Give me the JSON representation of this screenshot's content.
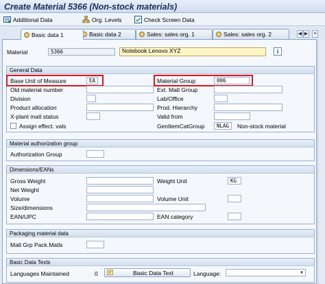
{
  "window": {
    "title": "Create Material 5366 (Non-stock materials)"
  },
  "toolbar": {
    "additional_data": "Additional Data",
    "org_levels": "Org. Levels",
    "check_screen_data": "Check Screen Data"
  },
  "tabs": [
    {
      "label": "Basic data 1",
      "active": true
    },
    {
      "label": "Basic data 2",
      "active": false
    },
    {
      "label": "Sales: sales org. 1",
      "active": false
    },
    {
      "label": "Sales: sales org. 2",
      "active": false
    }
  ],
  "header": {
    "material_label": "Material",
    "material_value": "5366",
    "description_value": "Notebook Lenovo XYZ",
    "info_icon": "info-icon"
  },
  "general": {
    "title": "General Data",
    "base_uom_label": "Base Unit of Measure",
    "base_uom_value": "EA",
    "old_material_label": "Old material number",
    "division_label": "Division",
    "product_allocation_label": "Product allocation",
    "xplant_status_label": "X-plant matl status",
    "assign_effect_label": "Assign effect. vals",
    "material_group_label": "Material Group",
    "material_group_value": "006",
    "ext_matl_group_label": "Ext. Matl Group",
    "lab_office_label": "Lab/Office",
    "prod_hierarchy_label": "Prod. Hierarchy",
    "valid_from_label": "Valid from",
    "gen_item_cat_label": "GenItemCatGroup",
    "gen_item_cat_value": "NLAG",
    "gen_item_cat_text": "Non-stock material"
  },
  "auth": {
    "title": "Material authorization group",
    "auth_group_label": "Authorization Group"
  },
  "dimensions": {
    "title": "Dimensions/EANs",
    "gross_weight_label": "Gross Weight",
    "net_weight_label": "Net Weight",
    "volume_label": "Volume",
    "size_label": "Size/dimensions",
    "ean_label": "EAN/UPC",
    "weight_unit_label": "Weight Unit",
    "weight_unit_value": "KG",
    "volume_unit_label": "Volume Unit",
    "ean_category_label": "EAN category"
  },
  "packaging": {
    "title": "Packaging material data",
    "matl_grp_label": "Matl Grp Pack.Matls"
  },
  "texts": {
    "title": "Basic Data Texts",
    "languages_label": "Languages Maintained",
    "languages_count": "0",
    "basic_data_text_button": "Basic Data Text",
    "language_label": "Language:"
  },
  "colors": {
    "highlight_box": "#e0141e",
    "title_text": "#1a2f5a",
    "background": "#dfe8f4"
  }
}
